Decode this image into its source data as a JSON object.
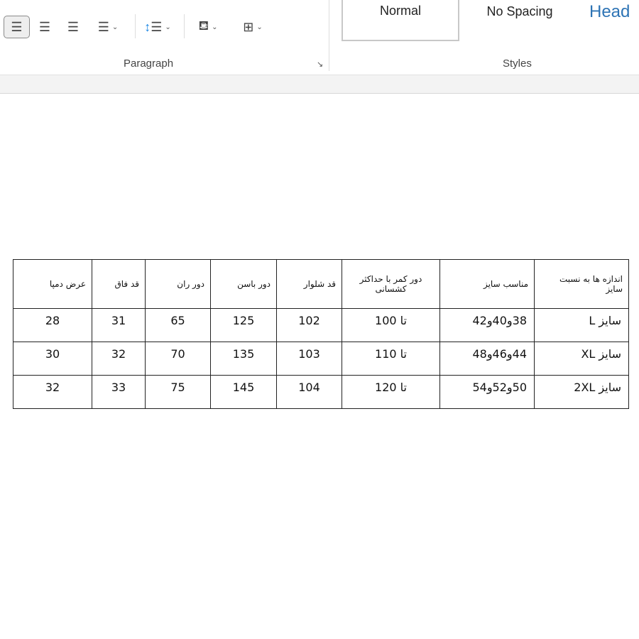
{
  "ribbon": {
    "paragraph_group": {
      "label": "Paragraph",
      "buttons": [
        {
          "name": "align-left",
          "icon": "align-left-icon",
          "selected": true
        },
        {
          "name": "align-center",
          "icon": "align-center-icon"
        },
        {
          "name": "align-right",
          "icon": "align-right-icon"
        },
        {
          "name": "justify",
          "icon": "justify-icon"
        },
        {
          "name": "line-spacing",
          "icon": "line-spacing-icon"
        },
        {
          "name": "shading",
          "icon": "paint-bucket-icon"
        },
        {
          "name": "borders",
          "icon": "borders-icon"
        }
      ]
    },
    "styles_group": {
      "label": "Styles",
      "items": [
        "Normal",
        "No Spacing",
        "Head"
      ]
    }
  },
  "table": {
    "headers": [
      "اندازه ها به نسبت سایز",
      "مناسب سایز",
      "دور کمر با حداکثر کشسانی",
      "قد شلوار",
      "دور باسن",
      "دور ران",
      "قد فاق",
      "عرض دمپا"
    ],
    "rows": [
      [
        "سایز  L",
        "38و40و42",
        "تا 100",
        "102",
        "125",
        "65",
        "31",
        "28"
      ],
      [
        "سایز  XL",
        "44و46و48",
        "تا 110",
        "103",
        "135",
        "70",
        "32",
        "30"
      ],
      [
        "سایز 2XL",
        "50و52و54",
        "تا 120",
        "104",
        "145",
        "75",
        "33",
        "32"
      ]
    ]
  }
}
